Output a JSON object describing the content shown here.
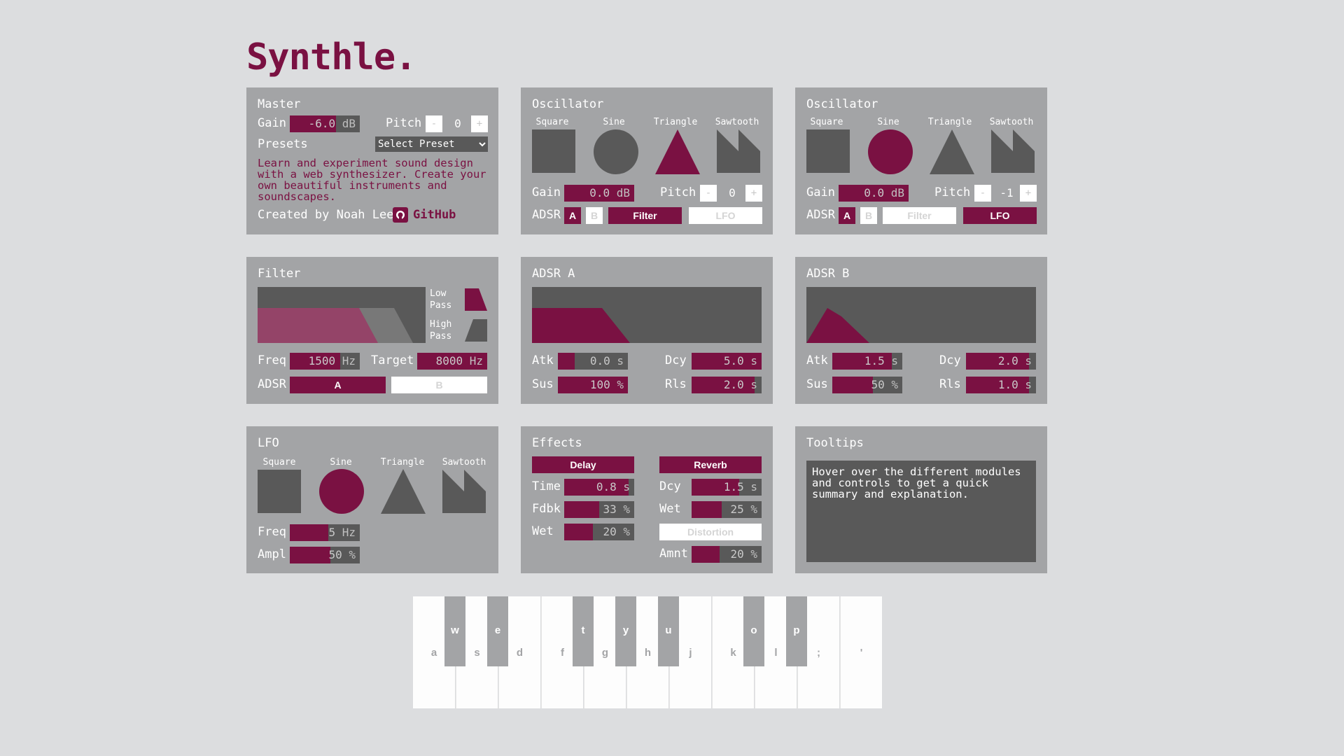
{
  "app": {
    "title": "Synthle."
  },
  "colors": {
    "accent": "#7a1142",
    "panel": "#a3a4a6",
    "dark": "#595959",
    "bg": "#dcdddf"
  },
  "master": {
    "heading": "Master",
    "gain_label": "Gain",
    "gain_value": "-6.0",
    "gain_unit": "dB",
    "pitch_label": "Pitch",
    "pitch_value": "0",
    "minus": "-",
    "plus": "+",
    "presets_label": "Presets",
    "preset_selected": "Select Preset",
    "description": "Learn and experiment sound design with a web synthesizer. Create your own beautiful instruments and soundscapes.",
    "credit": "Created by Noah Lee",
    "github_label": "GitHub",
    "github_icon": "github-icon"
  },
  "wave_labels": {
    "square": "Square",
    "sine": "Sine",
    "triangle": "Triangle",
    "sawtooth": "Sawtooth"
  },
  "osc1": {
    "heading": "Oscillator",
    "selected_wave": "triangle",
    "gain_label": "Gain",
    "gain_value": "0.0",
    "gain_unit": "dB",
    "pitch_label": "Pitch",
    "pitch_value": "0",
    "minus": "-",
    "plus": "+",
    "adsr_label": "ADSR",
    "a": "A",
    "b": "B",
    "filter": "Filter",
    "lfo": "LFO",
    "adsr_a_on": true,
    "adsr_b_on": false,
    "filter_on": true,
    "lfo_on": false
  },
  "osc2": {
    "heading": "Oscillator",
    "selected_wave": "sine",
    "gain_label": "Gain",
    "gain_value": "0.0",
    "gain_unit": "dB",
    "pitch_label": "Pitch",
    "pitch_value": "-1",
    "minus": "-",
    "plus": "+",
    "adsr_label": "ADSR",
    "a": "A",
    "b": "B",
    "filter": "Filter",
    "lfo": "LFO",
    "adsr_a_on": true,
    "adsr_b_on": false,
    "filter_on": false,
    "lfo_on": true
  },
  "filter": {
    "heading": "Filter",
    "low_pass": "Low Pass",
    "high_pass": "High Pass",
    "freq_label": "Freq",
    "freq_value": "1500",
    "freq_unit": "Hz",
    "target_label": "Target",
    "target_value": "8000",
    "target_unit": "Hz",
    "adsr_label": "ADSR",
    "a": "A",
    "b": "B"
  },
  "adsr_a": {
    "heading": "ADSR A",
    "atk_label": "Atk",
    "atk_value": "0.0",
    "atk_unit": "s",
    "dcy_label": "Dcy",
    "dcy_value": "5.0",
    "dcy_unit": "s",
    "sus_label": "Sus",
    "sus_value": "100",
    "sus_unit": "%",
    "rls_label": "Rls",
    "rls_value": "2.0",
    "rls_unit": "s"
  },
  "adsr_b": {
    "heading": "ADSR B",
    "atk_label": "Atk",
    "atk_value": "1.5",
    "atk_unit": "s",
    "dcy_label": "Dcy",
    "dcy_value": "2.0",
    "dcy_unit": "s",
    "sus_label": "Sus",
    "sus_value": "50",
    "sus_unit": "%",
    "rls_label": "Rls",
    "rls_value": "1.0",
    "rls_unit": "s"
  },
  "lfo": {
    "heading": "LFO",
    "selected_wave": "sine",
    "freq_label": "Freq",
    "freq_value": "5",
    "freq_unit": "Hz",
    "ampl_label": "Ampl",
    "ampl_value": "50",
    "ampl_unit": "%"
  },
  "effects": {
    "heading": "Effects",
    "delay": "Delay",
    "reverb": "Reverb",
    "distortion": "Distortion",
    "time_label": "Time",
    "time_value": "0.8",
    "time_unit": "s",
    "fdbk_label": "Fdbk",
    "fdbk_value": "33",
    "fdbk_unit": "%",
    "wet_label": "Wet",
    "wet_value": "20",
    "wet_unit": "%",
    "dcy_label": "Dcy",
    "dcy_value": "1.5",
    "dcy_unit": "s",
    "rwet_label": "Wet",
    "rwet_value": "25",
    "rwet_unit": "%",
    "amnt_label": "Amnt",
    "amnt_value": "20",
    "amnt_unit": "%"
  },
  "tooltips": {
    "heading": "Tooltips",
    "text": "Hover over the different modules and controls to get a quick summary and explanation."
  },
  "keyboard": {
    "white_keys": [
      "a",
      "s",
      "d",
      "f",
      "g",
      "h",
      "j",
      "k",
      "l",
      ";",
      "'"
    ],
    "black_keys": [
      "w",
      "e",
      "t",
      "y",
      "u",
      "o",
      "p"
    ]
  }
}
